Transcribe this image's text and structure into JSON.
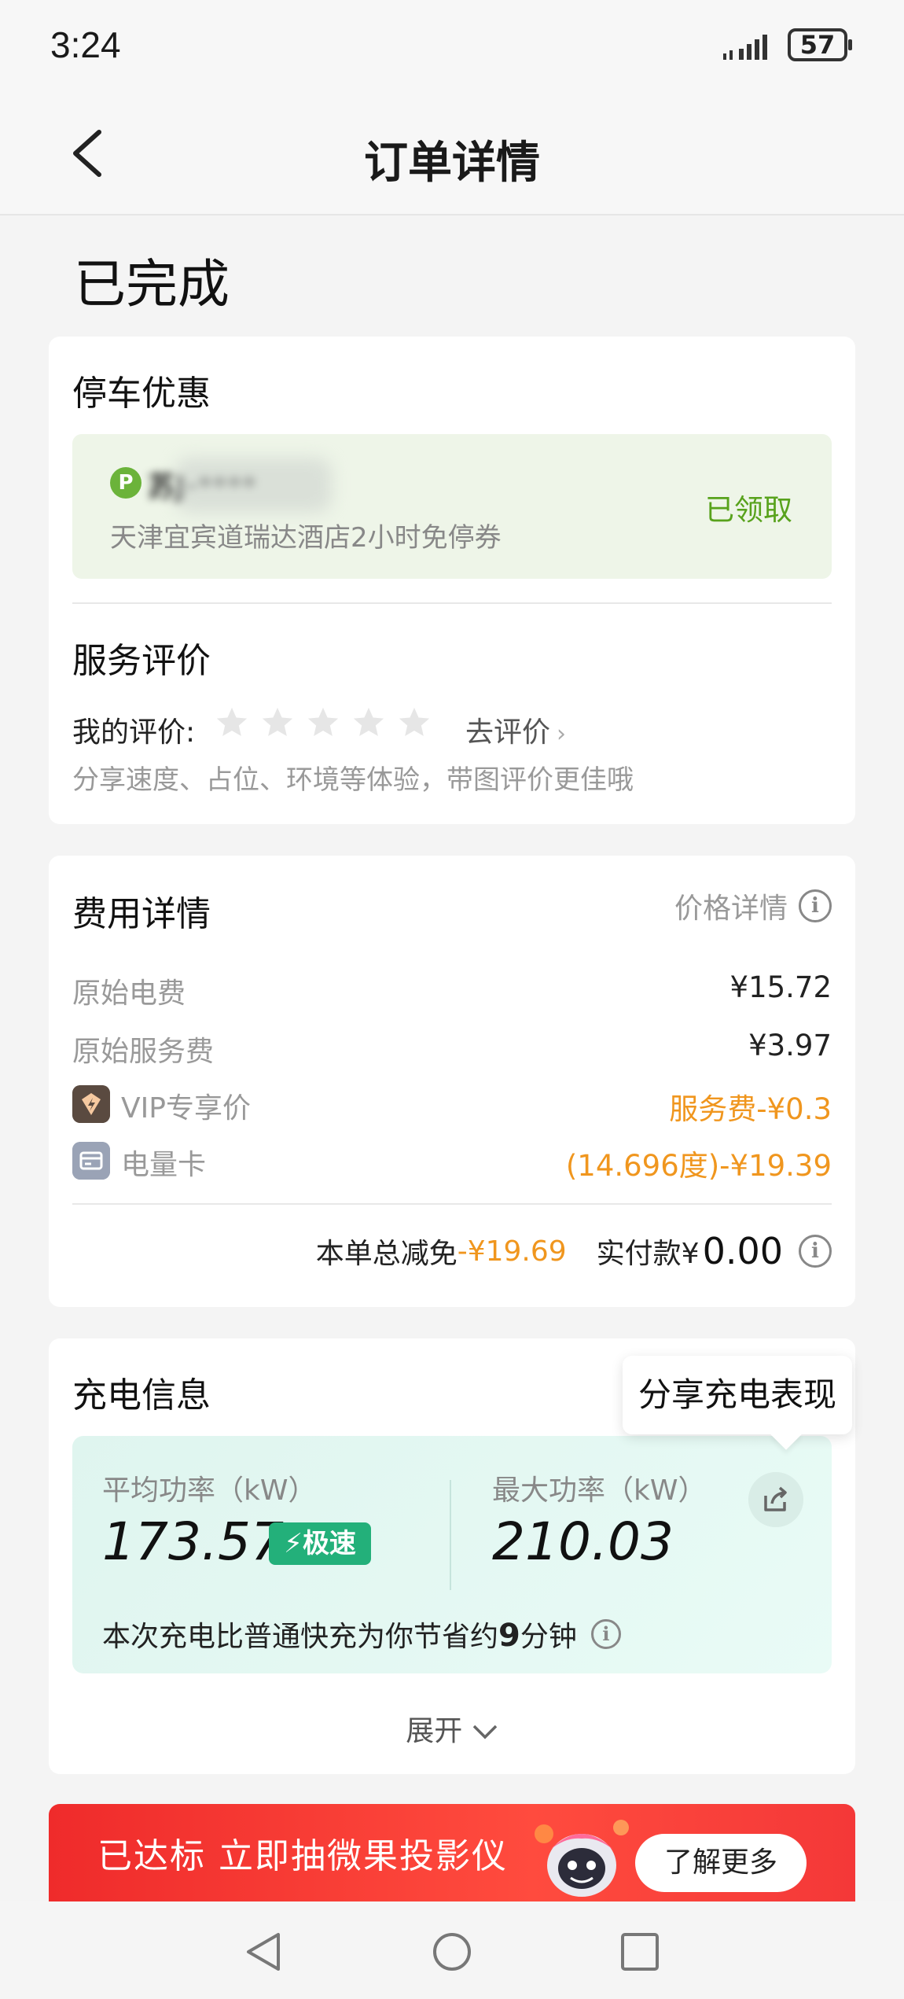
{
  "status_bar": {
    "time": "3:24",
    "battery": "57"
  },
  "nav": {
    "title": "订单详情"
  },
  "order": {
    "status": "已完成"
  },
  "parking": {
    "title": "停车优惠",
    "plate": "苏J·****",
    "coupon_desc": "天津宜宾道瑞达酒店2小时免停券",
    "coupon_status": "已领取"
  },
  "review": {
    "title": "服务评价",
    "my_rating_label": "我的评价:",
    "stars": 5,
    "go_review": "去评价",
    "hint": "分享速度、占位、环境等体验，带图评价更佳哦"
  },
  "fees": {
    "title": "费用详情",
    "price_detail_link": "价格详情",
    "rows": [
      {
        "label": "原始电费",
        "value": "¥15.72"
      },
      {
        "label": "原始服务费",
        "value": "¥3.97"
      },
      {
        "label": "VIP专享价",
        "value": "服务费-¥0.3"
      },
      {
        "label": "电量卡",
        "value": "(14.696度)-¥19.39"
      }
    ],
    "total_discount_label": "本单总减免",
    "total_discount_value": "-¥19.69",
    "paid_label": "实付款¥",
    "paid_value": "0.00"
  },
  "charging": {
    "title": "充电信息",
    "tooltip": "分享充电表现",
    "avg_power_label": "平均功率（kW）",
    "avg_power_value": "173.57",
    "speed_badge": "极速",
    "max_power_label": "最大功率（kW）",
    "max_power_value": "210.03",
    "save_prefix": "本次充电比普通快充为你节省约",
    "save_minutes": "9",
    "save_suffix": "分钟",
    "expand": "展开"
  },
  "banner": {
    "text": "已达标 立即抽微果投影仪",
    "button": "了解更多"
  },
  "colors": {
    "accent_green": "#58a21c",
    "orange": "#f0961e",
    "teal_badge": "#23b07a",
    "banner_red": "#ef2b2b"
  },
  "icons": [
    "back-icon",
    "signal-icon",
    "battery-icon",
    "parking-icon",
    "star-icon",
    "chevron-right-icon",
    "info-icon",
    "vip-icon",
    "card-icon",
    "bolt-icon",
    "share-icon",
    "chevron-down-icon",
    "nav-back-icon",
    "nav-home-icon",
    "nav-recent-icon"
  ]
}
